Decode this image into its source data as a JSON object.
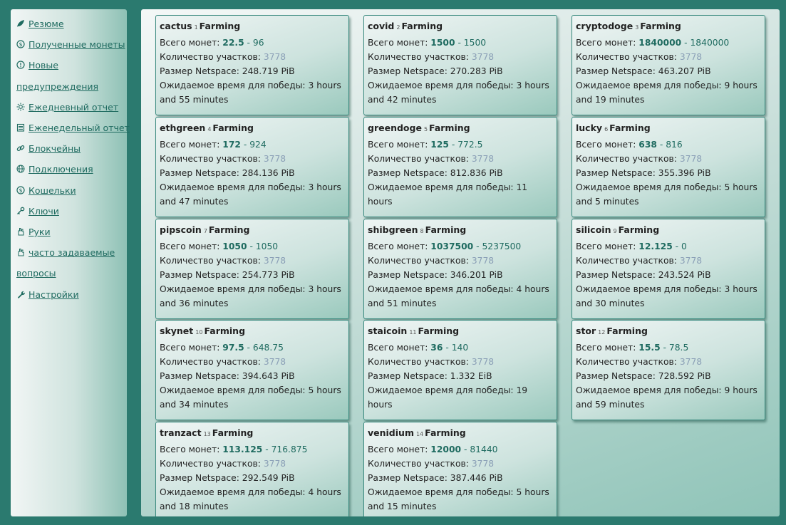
{
  "sidebar": {
    "items": [
      {
        "label": "Резюме",
        "icon": "leaf-icon"
      },
      {
        "label": "Полученные монеты",
        "icon": "dollar-coin-icon"
      },
      {
        "label": "Новые",
        "icon": "alert-circle-icon"
      },
      {
        "label": "предупреждения",
        "icon": ""
      },
      {
        "label": "Ежедневный отчет",
        "icon": "sun-icon"
      },
      {
        "label": "Еженедельный отчет",
        "icon": "calendar-icon"
      },
      {
        "label": "Блокчейны",
        "icon": "link-icon"
      },
      {
        "label": "Подключения",
        "icon": "globe-icon"
      },
      {
        "label": "Кошельки",
        "icon": "wallet-coin-icon"
      },
      {
        "label": "Ключи",
        "icon": "key-icon"
      },
      {
        "label": "Руки",
        "icon": "hand-icon"
      },
      {
        "label": "часто задаваемые",
        "icon": "hand-icon"
      },
      {
        "label": "вопросы",
        "icon": ""
      },
      {
        "label": "Настройки",
        "icon": "wrench-icon"
      }
    ]
  },
  "labels": {
    "status": "Farming",
    "coins": "Всего монет:",
    "participants": "Количество участков:",
    "netspace": "Размер Netspace:",
    "eta": "Ожидаемое время для победы:"
  },
  "cards": [
    {
      "name": "cactus",
      "idx": "1",
      "coins_a": "22.5",
      "coins_b": "96",
      "participants": "3778",
      "netspace": "248.719 PiB",
      "eta1": "3 hours",
      "eta2": "and 55 minutes"
    },
    {
      "name": "covid",
      "idx": "2",
      "coins_a": "1500",
      "coins_b": "1500",
      "participants": "3778",
      "netspace": "270.283 PiB",
      "eta1": "3 hours",
      "eta2": "and 42 minutes"
    },
    {
      "name": "cryptodoge",
      "idx": "3",
      "coins_a": "1840000",
      "coins_b": "1840000",
      "participants": "3778",
      "netspace": "463.207 PiB",
      "eta1": "9 hours",
      "eta2": "and 19 minutes"
    },
    {
      "name": "ethgreen",
      "idx": "4",
      "coins_a": "172",
      "coins_b": "924",
      "participants": "3778",
      "netspace": "284.136 PiB",
      "eta1": "3 hours",
      "eta2": "and 47 minutes"
    },
    {
      "name": "greendoge",
      "idx": "5",
      "coins_a": "125",
      "coins_b": "772.5",
      "participants": "3778",
      "netspace": "812.836 PiB",
      "eta1": "11 hours",
      "eta2": ""
    },
    {
      "name": "lucky",
      "idx": "6",
      "coins_a": "638",
      "coins_b": "816",
      "participants": "3778",
      "netspace": "355.396 PiB",
      "eta1": "5 hours",
      "eta2": "and 5 minutes"
    },
    {
      "name": "pipscoin",
      "idx": "7",
      "coins_a": "1050",
      "coins_b": "1050",
      "participants": "3778",
      "netspace": "254.773 PiB",
      "eta1": "3 hours",
      "eta2": "and 36 minutes"
    },
    {
      "name": "shibgreen",
      "idx": "8",
      "coins_a": "1037500",
      "coins_b": "5237500",
      "participants": "3778",
      "netspace": "346.201 PiB",
      "eta1": "4 hours",
      "eta2": "and 51 minutes"
    },
    {
      "name": "silicoin",
      "idx": "9",
      "coins_a": "12.125",
      "coins_b": "0",
      "participants": "3778",
      "netspace": "243.524 PiB",
      "eta1": "3 hours",
      "eta2": "and 30 minutes"
    },
    {
      "name": "skynet",
      "idx": "10",
      "coins_a": "97.5",
      "coins_b": "648.75",
      "participants": "3778",
      "netspace": "394.643 PiB",
      "eta1": "5 hours",
      "eta2": "and 34 minutes"
    },
    {
      "name": "staicoin",
      "idx": "11",
      "coins_a": "36",
      "coins_b": "140",
      "participants": "3778",
      "netspace": "1.332 EiB",
      "eta1": "19 hours",
      "eta2": ""
    },
    {
      "name": "stor",
      "idx": "12",
      "coins_a": "15.5",
      "coins_b": "78.5",
      "participants": "3778",
      "netspace": "728.592 PiB",
      "eta1": "9 hours",
      "eta2": "and 59 minutes"
    },
    {
      "name": "tranzact",
      "idx": "13",
      "coins_a": "113.125",
      "coins_b": "716.875",
      "participants": "3778",
      "netspace": "292.549 PiB",
      "eta1": "4 hours",
      "eta2": "and 18 minutes"
    },
    {
      "name": "venidium",
      "idx": "14",
      "coins_a": "12000",
      "coins_b": "81440",
      "participants": "3778",
      "netspace": "387.446 PiB",
      "eta1": "5 hours",
      "eta2": "and 15 minutes"
    }
  ]
}
